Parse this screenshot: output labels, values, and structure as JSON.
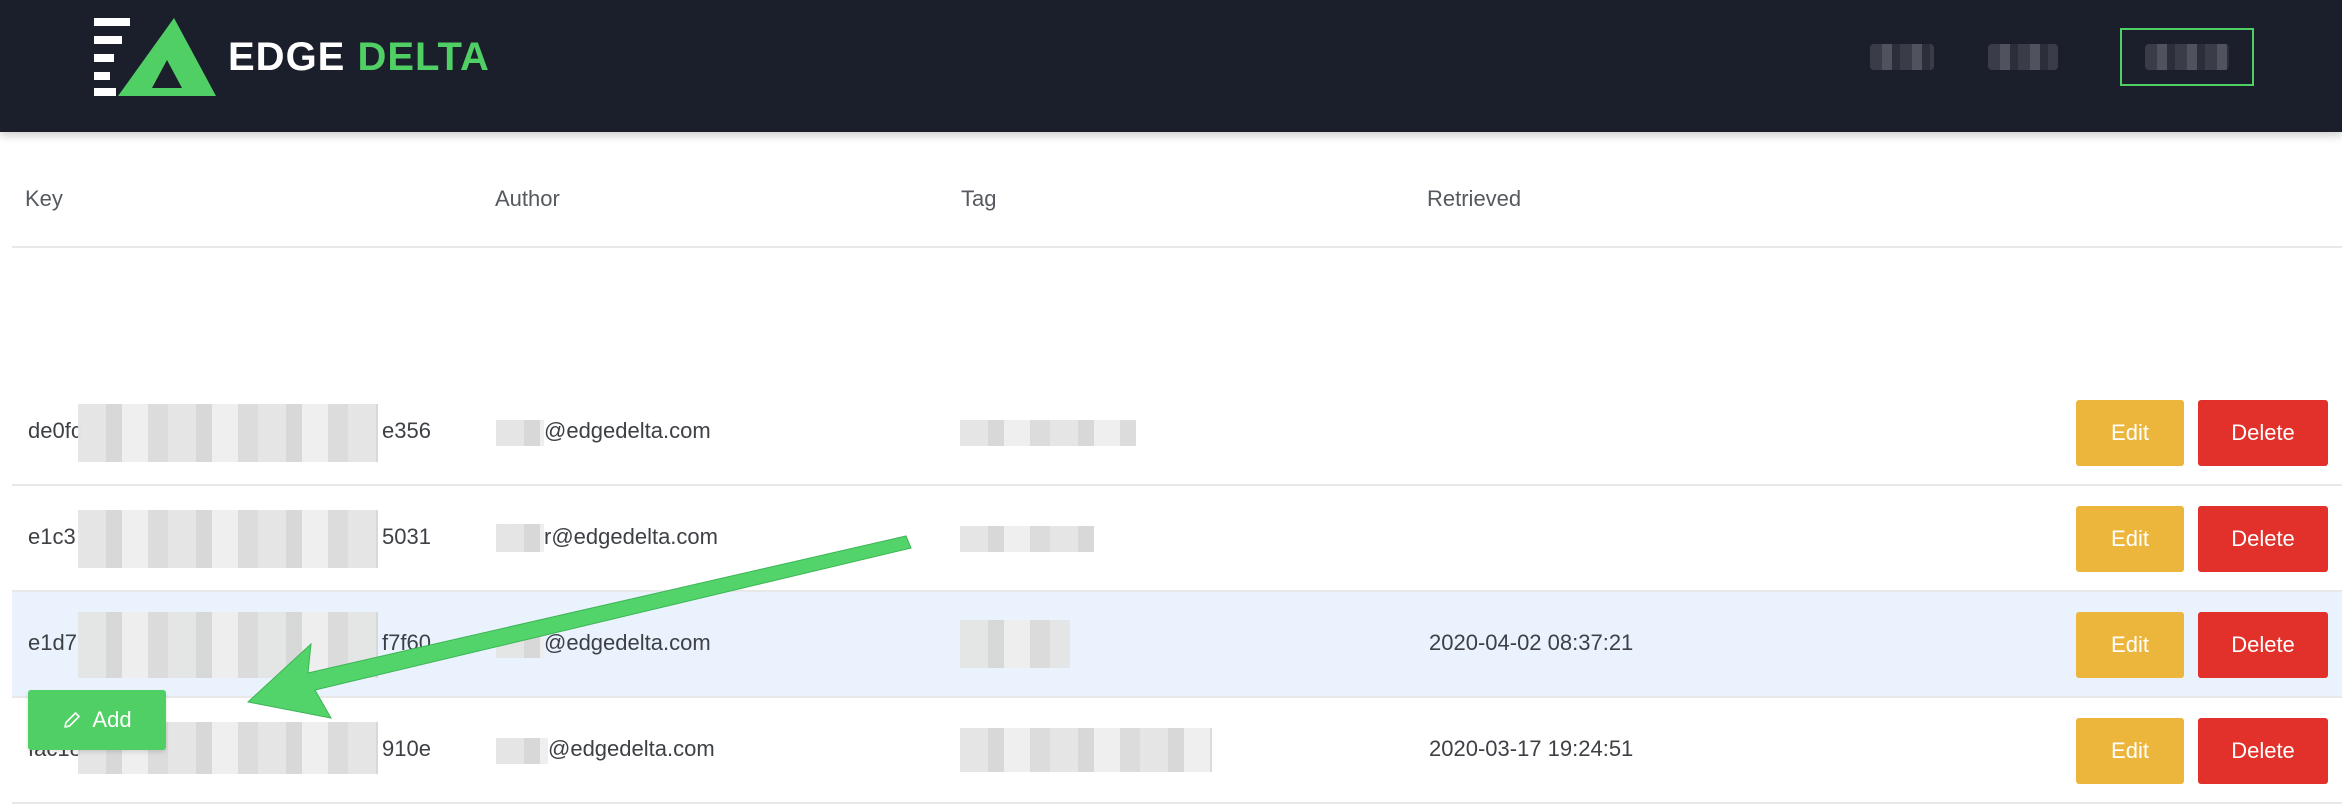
{
  "header": {
    "brand_word1": "EDGE",
    "brand_word2": "DELTA",
    "brand_colors": {
      "white": "#ffffff",
      "green": "#4fcf64"
    },
    "nav_items": [
      "",
      "",
      ""
    ],
    "background": "#1b1e2b"
  },
  "table": {
    "columns": [
      "Key",
      "Author",
      "Tag",
      "Retrieved"
    ],
    "rows": [
      {
        "key_prefix": "de0fc",
        "key_suffix": "e356",
        "author": "@edgedelta.com",
        "retrieved": ""
      },
      {
        "key_prefix": "e1c3",
        "key_suffix": "5031",
        "author": "r@edgedelta.com",
        "retrieved": ""
      },
      {
        "key_prefix": "e1d7",
        "key_suffix": "f7f60",
        "author": "@edgedelta.com",
        "retrieved": "2020-04-02 08:37:21"
      },
      {
        "key_prefix": "fac18",
        "key_suffix": "910e",
        "author": "@edgedelta.com",
        "retrieved": "2020-03-17 19:24:51"
      }
    ],
    "edit_label": "Edit",
    "delete_label": "Delete",
    "edit_color": "#ecb63c",
    "delete_color": "#e2302a",
    "highlight_row_color": "#eaf3fd"
  },
  "footer": {
    "add_label": "Add",
    "add_icon": "pencil-icon",
    "add_color": "#4fcf64"
  },
  "annotation": {
    "arrow_color": "#52d46a"
  }
}
